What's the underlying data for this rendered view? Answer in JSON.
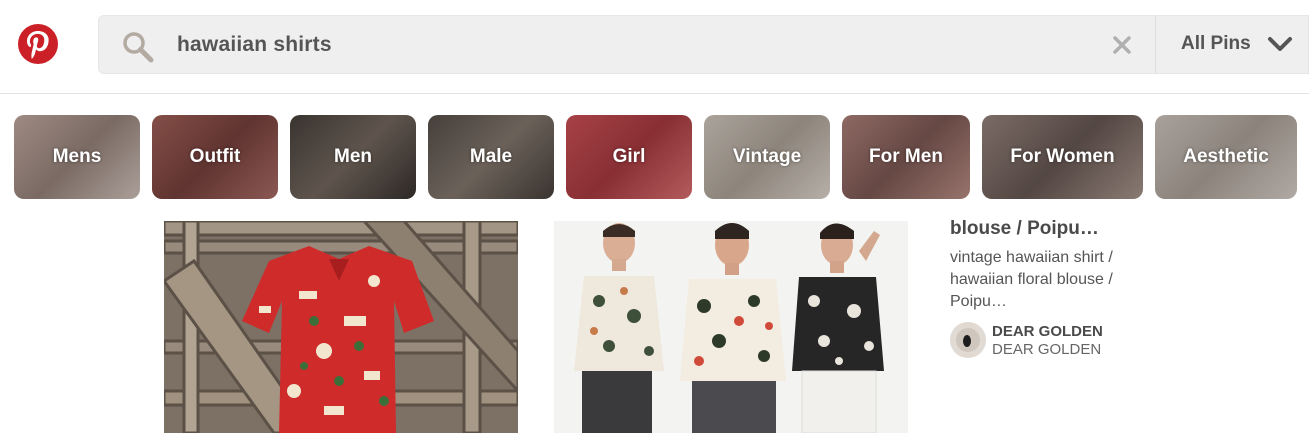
{
  "search": {
    "query": "hawaiian shirts",
    "scope": "All Pins"
  },
  "guides": [
    {
      "label": "Mens",
      "color": "#a39088"
    },
    {
      "label": "Outfit",
      "color": "#7e4a45"
    },
    {
      "label": "Men",
      "color": "#4a4640"
    },
    {
      "label": "Male",
      "color": "#5a5550"
    },
    {
      "label": "Girl",
      "color": "#b7474b"
    },
    {
      "label": "Vintage",
      "color": "#b3aca2"
    },
    {
      "label": "For Men",
      "color": "#8f6b66"
    },
    {
      "label": "For Women",
      "color": "#7a6c66"
    },
    {
      "label": "Aesthetic",
      "color": "#b8b2ab"
    }
  ],
  "pin": {
    "title": "blouse / Poipu…",
    "description": "vintage hawaiian shirt / hawaiian floral blouse / Poipu…",
    "pinner_name": "DEAR GOLDEN",
    "board_name": "DEAR GOLDEN"
  },
  "colors": {
    "brand": "#cb2027",
    "text": "#555555"
  }
}
